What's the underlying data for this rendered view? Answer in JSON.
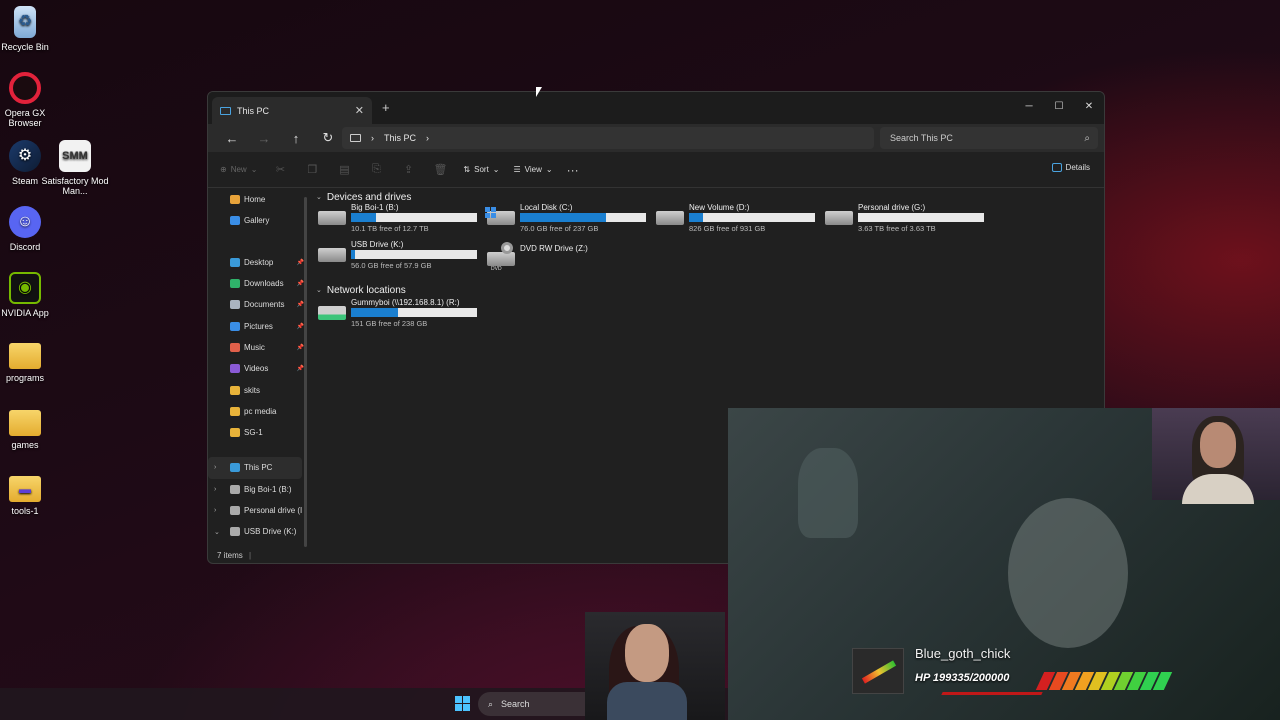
{
  "desktop": {
    "icons": [
      {
        "label": "Recycle Bin",
        "icon": "recycle-bin-icon"
      },
      {
        "label": "Opera GX Browser",
        "icon": "opera-gx-icon"
      },
      {
        "label": "Steam",
        "icon": "steam-icon"
      },
      {
        "label": "Satisfactory Mod Man...",
        "icon": "smm-icon",
        "glyph": "SMM"
      },
      {
        "label": "Discord",
        "icon": "discord-icon"
      },
      {
        "label": "NVIDIA App",
        "icon": "nvidia-icon"
      },
      {
        "label": "programs",
        "icon": "folder-icon"
      },
      {
        "label": "games",
        "icon": "folder-icon"
      },
      {
        "label": "tools-1",
        "icon": "folder-icon"
      }
    ]
  },
  "explorer": {
    "tab_title": "This PC",
    "address": {
      "segment": "This PC"
    },
    "search": {
      "placeholder": "Search This PC"
    },
    "toolbar": {
      "new": "New",
      "sort": "Sort",
      "view": "View",
      "details": "Details"
    },
    "sidebar": {
      "top": [
        {
          "label": "Home",
          "icon": "home-icon",
          "color": "#e8a33a"
        },
        {
          "label": "Gallery",
          "icon": "gallery-icon",
          "color": "#3a8ee6"
        }
      ],
      "pinned": [
        {
          "label": "Desktop",
          "icon": "desktop-icon",
          "color": "#3a9ad9",
          "pinned": true
        },
        {
          "label": "Downloads",
          "icon": "downloads-icon",
          "color": "#2fb36a",
          "pinned": true
        },
        {
          "label": "Documents",
          "icon": "documents-icon",
          "color": "#aab4c0",
          "pinned": true
        },
        {
          "label": "Pictures",
          "icon": "pictures-icon",
          "color": "#3a8ee6",
          "pinned": true
        },
        {
          "label": "Music",
          "icon": "music-icon",
          "color": "#e0604a",
          "pinned": true
        },
        {
          "label": "Videos",
          "icon": "videos-icon",
          "color": "#8a5ad6",
          "pinned": true
        },
        {
          "label": "skits",
          "icon": "folder-icon",
          "color": "#e8b33a",
          "pinned": false
        },
        {
          "label": "pc media",
          "icon": "folder-icon",
          "color": "#e8b33a",
          "pinned": false
        },
        {
          "label": "SG-1",
          "icon": "folder-icon",
          "color": "#e8b33a",
          "pinned": false
        }
      ],
      "tree": [
        {
          "label": "This PC",
          "icon": "this-pc-icon",
          "color": "#3a9ad9",
          "chevron": "›",
          "selected": true
        },
        {
          "label": "Big Boi-1 (B:)",
          "icon": "drive-icon",
          "color": "#aaaaaa",
          "chevron": "›",
          "selected": false
        },
        {
          "label": "Personal drive (I",
          "icon": "drive-icon",
          "color": "#aaaaaa",
          "chevron": "›",
          "selected": false
        },
        {
          "label": "USB Drive (K:)",
          "icon": "drive-icon",
          "color": "#aaaaaa",
          "chevron": "⌄",
          "selected": false
        }
      ]
    },
    "groups": {
      "devices": "Devices and drives",
      "network": "Network locations"
    },
    "drives": [
      {
        "name": "Big Boi-1 (B:)",
        "free": "10.1 TB free of 12.7 TB",
        "used_fraction": 0.2
      },
      {
        "name": "Local Disk (C:)",
        "free": "76.0 GB free of 237 GB",
        "used_fraction": 0.68
      },
      {
        "name": "New Volume (D:)",
        "free": "826 GB free of 931 GB",
        "used_fraction": 0.11
      },
      {
        "name": "Personal drive (G:)",
        "free": "3.63 TB free of 3.63 TB",
        "used_fraction": 0.0
      },
      {
        "name": "USB Drive (K:)",
        "free": "56.0 GB free of 57.9 GB",
        "used_fraction": 0.03
      },
      {
        "name": "DVD RW Drive (Z:)",
        "free": "",
        "badge": "DVD"
      }
    ],
    "network": [
      {
        "name": "Gummyboi (\\\\192.168.8.1) (R:)",
        "free": "151 GB free of 238 GB",
        "used_fraction": 0.37
      }
    ],
    "status": "7 items"
  },
  "taskbar": {
    "search": "Search"
  },
  "overlay": {
    "username": "Blue_goth_chick",
    "hp": "HP 199335/200000",
    "hp_fraction": 0.9967,
    "hp_colors": [
      "#d42020",
      "#e84a20",
      "#f07a20",
      "#f0a020",
      "#e0c020",
      "#b0d020",
      "#70d030",
      "#40d040",
      "#30d050",
      "#30d050"
    ]
  }
}
